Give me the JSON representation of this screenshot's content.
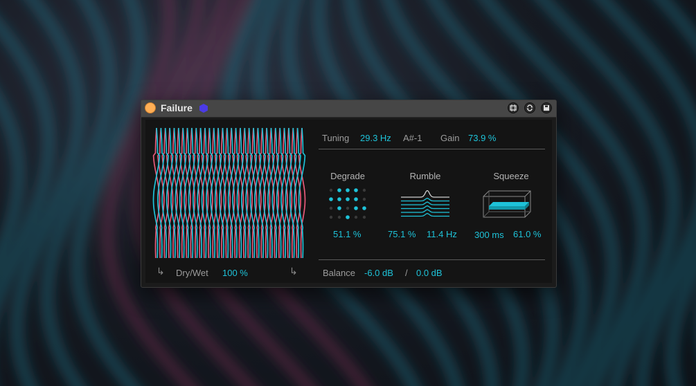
{
  "device": {
    "title": "Failure",
    "colors": {
      "accent": "#1ec3d9",
      "pink": "#e85a7a",
      "power": "#ffae55",
      "logo": "#4b3be6"
    },
    "icons": [
      "power-button",
      "hexagon-logo-icon",
      "map-icon",
      "loop-icon",
      "save-icon"
    ]
  },
  "tuning": {
    "label": "Tuning",
    "hz": "29.3 Hz",
    "note": "A#-1"
  },
  "gain": {
    "label": "Gain",
    "value": "73.9 %"
  },
  "degrade": {
    "title": "Degrade",
    "value": "51.1 %"
  },
  "rumble": {
    "title": "Rumble",
    "amount": "75.1 %",
    "freq": "11.4 Hz"
  },
  "squeeze": {
    "title": "Squeeze",
    "time": "300 ms",
    "amount": "61.0 %"
  },
  "drywet": {
    "label": "Dry/Wet",
    "value": "100 %"
  },
  "balance": {
    "label": "Balance",
    "left": "-6.0 dB",
    "sep": "/",
    "right": "0.0 dB"
  }
}
